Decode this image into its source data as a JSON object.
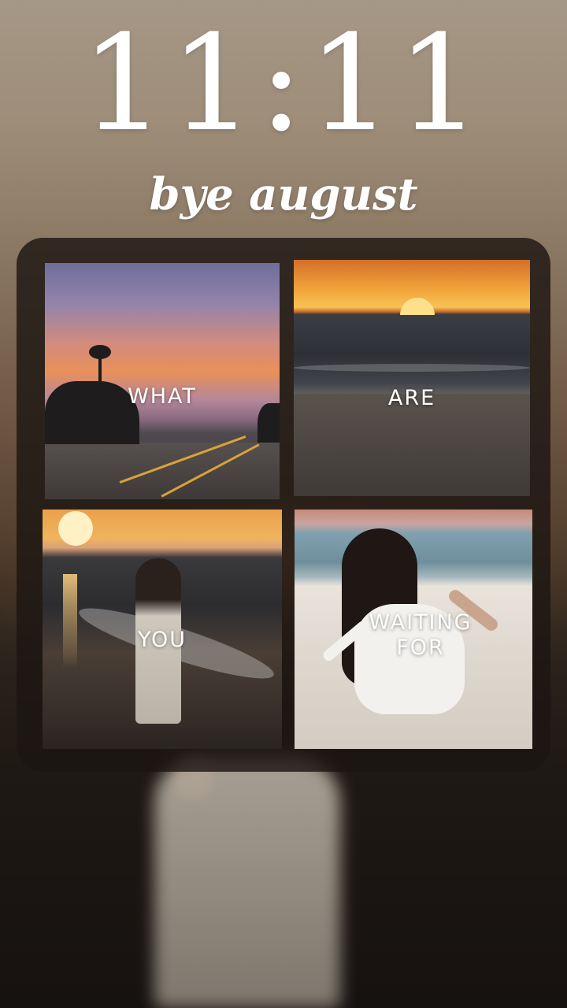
{
  "lockscreen": {
    "time": "11:11",
    "subtitle": "bye august"
  },
  "widget": {
    "tiles": [
      {
        "label": "WHAT",
        "scene": "road at sunset with palm trees"
      },
      {
        "label": "ARE",
        "scene": "sunset over ocean and beach"
      },
      {
        "label": "YOU",
        "scene": "girl in white dress walking in surf at sunset"
      },
      {
        "label": "WAITING\nFOR",
        "scene": "girl sitting on sandy beach"
      }
    ]
  },
  "colors": {
    "text": "#ffffff",
    "widget_background": "#1c1612"
  }
}
